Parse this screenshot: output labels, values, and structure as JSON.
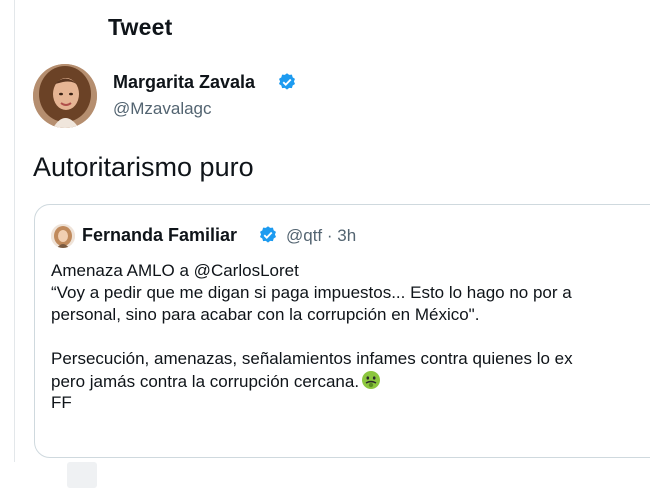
{
  "header": {
    "title": "Tweet"
  },
  "tweet": {
    "author_name": "Margarita Zavala",
    "author_handle": "@Mzavalagc",
    "verified": true,
    "text": "Autoritarismo puro"
  },
  "quote": {
    "author_name": "Fernanda Familiar",
    "verified": true,
    "meta": "@qtf · 3h",
    "lines": {
      "l1": "Amenaza AMLO a @CarlosLoret",
      "l2": "“Voy a pedir que me digan si paga impuestos... Esto lo hago no por a",
      "l3": "personal, sino para acabar con la corrupción en México\".",
      "l4": "Persecución, amenazas, señalamientos infames contra quienes lo ex",
      "l5": "pero jamás contra la corrupción cercana.",
      "l6": "FF"
    },
    "emoji": "nauseated-face-icon"
  },
  "colors": {
    "verified_blue": "#1d9bf0",
    "secondary_text": "#536471",
    "border": "#cfd9de"
  }
}
